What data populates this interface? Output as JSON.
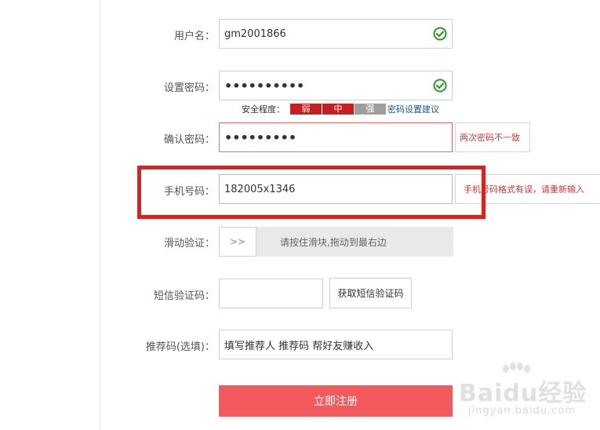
{
  "form": {
    "username": {
      "label": "用户名：",
      "value": "gm2001866"
    },
    "password": {
      "label": "设置密码：",
      "value": "••••••••••",
      "strength_label": "安全程度：",
      "strength_levels": [
        "弱",
        "中",
        "强"
      ],
      "strength_tip": "密码设置建议"
    },
    "confirm": {
      "label": "确认密码：",
      "value": "•••••••••",
      "error": "两次密码不一致"
    },
    "phone": {
      "label": "手机号码：",
      "value": "182005x1346",
      "error": "手机号码格式有误，请重新输入"
    },
    "slider": {
      "label": "滑动验证：",
      "handle": ">>",
      "hint": "请按住滑块,拖动到最右边"
    },
    "sms": {
      "label": "短信验证码：",
      "value": "",
      "button": "获取短信验证码"
    },
    "referral": {
      "label": "推荐码(选填)：",
      "placeholder": "填写推荐人 推荐码 帮好友赚收入"
    },
    "submit": "立即注册"
  },
  "colors": {
    "accent": "#f25a5e",
    "error": "#d9353a",
    "highlight": "#e01f1f",
    "strength_weak": "#c51f1f",
    "strength_medium": "#c51f1f",
    "strength_strong": "#9e9e9e",
    "success": "#2c9a2c"
  },
  "watermark": {
    "logo": "Baidu经验",
    "sub": "jingyan.baidu.com"
  }
}
